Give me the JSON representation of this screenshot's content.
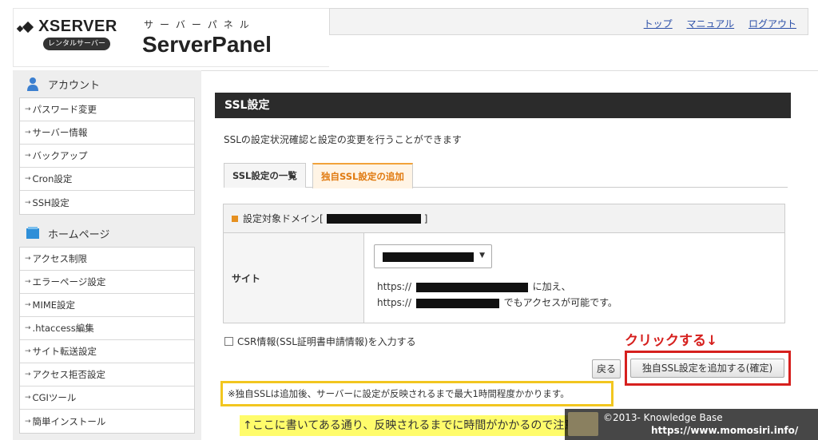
{
  "header": {
    "brand": "XSERVER",
    "rental_badge": "レンタルサーバー",
    "panel_sub": "サーバーパネル",
    "panel_title": "ServerPanel",
    "links": [
      "トップ",
      "マニュアル",
      "ログアウト"
    ]
  },
  "sidebar": {
    "sections": [
      {
        "title": "アカウント",
        "icon": "user-icon",
        "items": [
          "パスワード変更",
          "サーバー情報",
          "バックアップ",
          "Cron設定",
          "SSH設定"
        ]
      },
      {
        "title": "ホームページ",
        "icon": "book-icon",
        "items": [
          "アクセス制限",
          "エラーページ設定",
          "MIME設定",
          ".htaccess編集",
          "サイト転送設定",
          "アクセス拒否設定",
          "CGIツール",
          "簡単インストール"
        ]
      }
    ]
  },
  "main": {
    "title": "SSL設定",
    "description": "SSLの設定状況確認と設定の変更を行うことができます",
    "tabs": [
      {
        "label": "SSL設定の一覧",
        "active": false
      },
      {
        "label": "独自SSL設定の追加",
        "active": true
      }
    ],
    "domain_label_prefix": "設定対象ドメイン[",
    "domain_label_suffix": "]",
    "site_label": "サイト",
    "https1": "https://",
    "line1_suffix": "に加え、",
    "https2": "https://",
    "line2_suffix": "でもアクセスが可能です。",
    "csr_label": "CSR情報(SSL証明書申請情報)を入力する",
    "click_note": "クリックする↓",
    "back_button": "戻る",
    "confirm_button": "独自SSL設定を追加する(確定)",
    "notice": "※独自SSLは追加後、サーバーに設定が反映されるまで最大1時間程度かかります。",
    "yellow_note": "↑ここに書いてある通り、反映されるまでに時間がかかるので注意"
  },
  "watermark": {
    "line1": "©2013- Knowledge Base",
    "line2": "https://www.momosiri.info/"
  },
  "colors": {
    "accent_orange": "#e07a10",
    "highlight_red": "#d6201e",
    "highlight_yellow": "#f2c61f",
    "titlebar": "#2b2b2b",
    "link": "#2b4fa8"
  }
}
